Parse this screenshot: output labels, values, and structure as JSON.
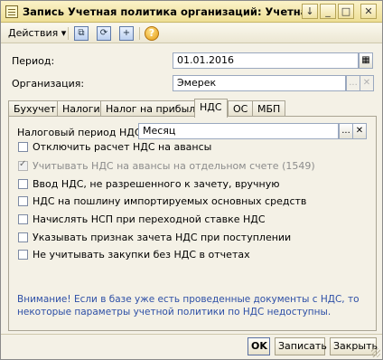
{
  "window": {
    "title": "Запись Учетная политика организаций: Учетная по...:",
    "buttons": {
      "menu": "↓",
      "minimize": "_",
      "maximize": "□",
      "close": "✕"
    }
  },
  "toolbar": {
    "actions_label": "Действия",
    "actions_arrow": "▾",
    "icons": [
      "copy-icon",
      "refresh-icon",
      "new-icon",
      "help-icon"
    ],
    "help_glyph": "?"
  },
  "form": {
    "period_label": "Период:",
    "period_value": "01.01.2016",
    "org_label": "Организация:",
    "org_value": "Эмерек",
    "org_btn_dots": "...",
    "org_btn_clear": "✕"
  },
  "tabs": [
    {
      "label": "Бухучет"
    },
    {
      "label": "Налоги"
    },
    {
      "label": "Налог на прибыль"
    },
    {
      "label": "НДС",
      "active": true
    },
    {
      "label": "ОС"
    },
    {
      "label": "МБП"
    }
  ],
  "vat": {
    "period_label": "Налоговый период НДС:",
    "period_value": "Месяц",
    "btn_dots": "...",
    "btn_clear": "✕",
    "options": [
      {
        "label": "Отключить расчет НДС на авансы",
        "checked": false,
        "disabled": false
      },
      {
        "label": "Учитывать НДС на авансы на отдельном счете (1549)",
        "checked": true,
        "disabled": true
      },
      {
        "label": "Ввод НДС, не разрешенного к зачету, вручную",
        "checked": false,
        "disabled": false
      },
      {
        "label": "НДС на пошлину импортируемых основных средств",
        "checked": false,
        "disabled": false
      },
      {
        "label": "Начислять НСП при переходной ставке НДС",
        "checked": false,
        "disabled": false
      },
      {
        "label": "Указывать признак зачета НДС при поступлении",
        "checked": false,
        "disabled": false
      },
      {
        "label": "Не учитывать закупки без НДС в отчетах",
        "checked": false,
        "disabled": false
      }
    ],
    "note": "Внимание! Если в базе уже есть проведенные документы с НДС, то некоторые параметры учетной политики по НДС недоступны."
  },
  "footer": {
    "ok": "OK",
    "save": "Записать",
    "close": "Закрыть"
  },
  "colors": {
    "title_bg": "#eedf96",
    "window_bg": "#f4f1e6",
    "note_text": "#2d4fa6"
  }
}
